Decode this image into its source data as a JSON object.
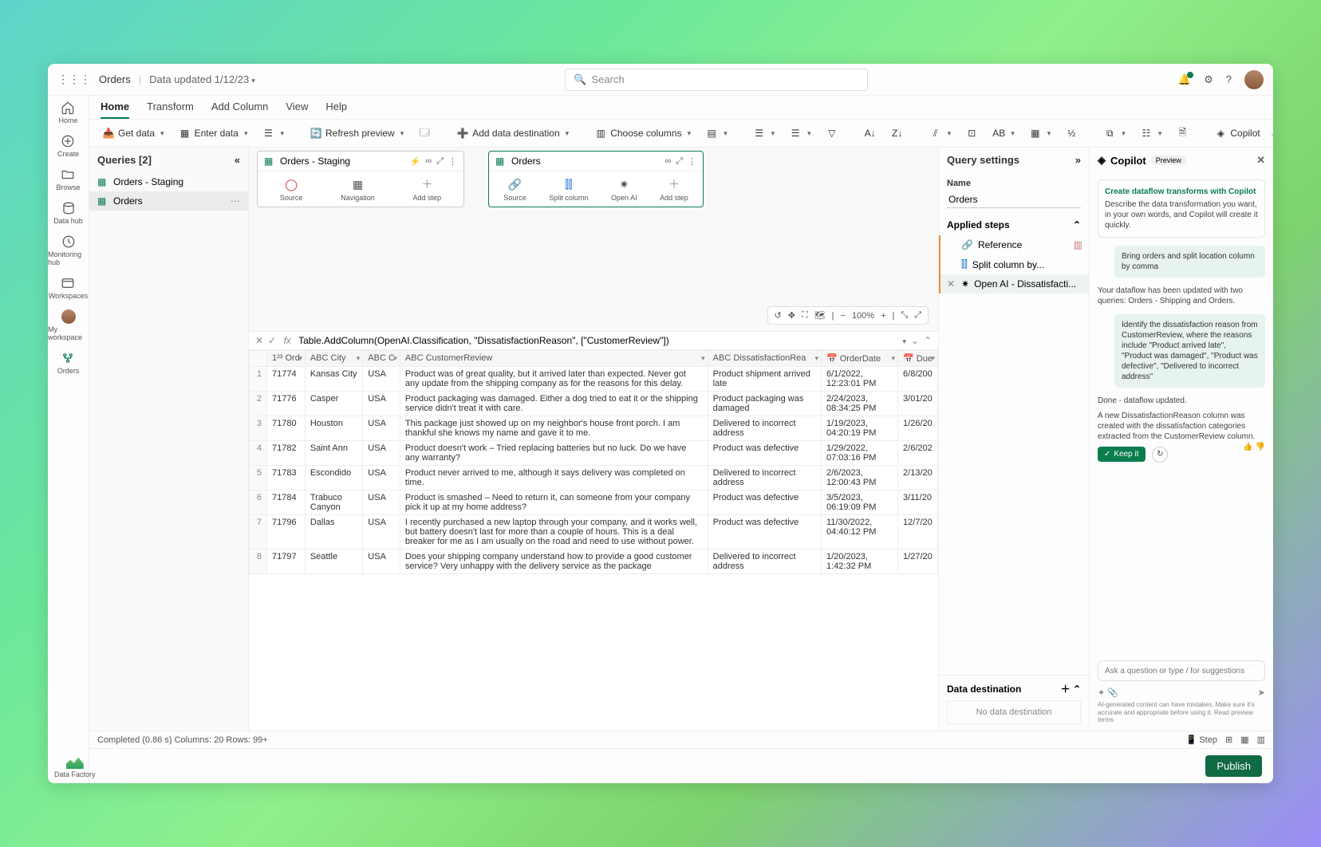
{
  "topbar": {
    "title": "Orders",
    "subtitle": "Data updated 1/12/23",
    "search_placeholder": "Search"
  },
  "rail": [
    {
      "label": "Home"
    },
    {
      "label": "Create"
    },
    {
      "label": "Browse"
    },
    {
      "label": "Data hub"
    },
    {
      "label": "Monitoring hub"
    },
    {
      "label": "Workspaces"
    },
    {
      "label": "My workspace"
    },
    {
      "label": "Orders"
    }
  ],
  "tabs": [
    "Home",
    "Transform",
    "Add Column",
    "View",
    "Help"
  ],
  "ribbon": {
    "get_data": "Get data",
    "enter_data": "Enter data",
    "refresh": "Refresh preview",
    "add_dest": "Add data destination",
    "choose_cols": "Choose columns",
    "copilot": "Copilot"
  },
  "queries": {
    "header": "Queries [2]",
    "items": [
      {
        "name": "Orders - Staging"
      },
      {
        "name": "Orders"
      }
    ]
  },
  "diagram": {
    "box1": {
      "title": "Orders - Staging",
      "steps": [
        "Source",
        "Navigation",
        "Add step"
      ]
    },
    "box2": {
      "title": "Orders",
      "steps": [
        "Source",
        "Split column",
        "Open AI",
        "Add step"
      ]
    },
    "zoom": "100%"
  },
  "formula": "Table.AddColumn(OpenAI.Classification, \"DissatisfactionReason\", [\"CustomerReview\"])",
  "grid": {
    "headers": [
      "",
      "1²³ Ord",
      "ABC City",
      "ABC C",
      "ABC CustomerReview",
      "ABC DissatisfactionRea",
      "📅 OrderDate",
      "📅 Due"
    ],
    "rows": [
      [
        "1",
        "71774",
        "Kansas City",
        "USA",
        "Product was of great quality, but it arrived later than expected. Never got any update from the shipping company as for the reasons for this delay.",
        "Product shipment arrived late",
        "6/1/2022, 12:23:01 PM",
        "6/8/200"
      ],
      [
        "2",
        "71776",
        "Casper",
        "USA",
        "Product packaging was damaged. Either a dog tried to eat it or the shipping service didn't treat it with care.",
        "Product packaging was damaged",
        "2/24/2023, 08:34:25 PM",
        "3/01/20"
      ],
      [
        "3",
        "71780",
        "Houston",
        "USA",
        "This package just showed up on my neighbor's house front porch. I am thankful she knows my name and gave it to me.",
        "Delivered to incorrect address",
        "1/19/2023, 04:20:19 PM",
        "1/26/20"
      ],
      [
        "4",
        "71782",
        "Saint Ann",
        "USA",
        "Product doesn't work – Tried replacing batteries but no luck. Do we have any warranty?",
        "Product was defective",
        "1/29/2022, 07:03:16 PM",
        "2/6/202"
      ],
      [
        "5",
        "71783",
        "Escondido",
        "USA",
        "Product never arrived to me, although it says delivery was completed on time.",
        "Delivered to incorrect address",
        "2/6/2023, 12:00:43 PM",
        "2/13/20"
      ],
      [
        "6",
        "71784",
        "Trabuco Canyon",
        "USA",
        "Product is smashed – Need to return it, can someone from your company pick it up at my home address?",
        "Product was defective",
        "3/5/2023, 06:19:09 PM",
        "3/11/20"
      ],
      [
        "7",
        "71796",
        "Dallas",
        "USA",
        "I recently purchased a new laptop through your company, and it works well, but battery doesn't last for more than a couple of hours. This is a deal breaker for me as I am usually on the road and need to use without power.",
        "Product was defective",
        "11/30/2022, 04:40:12 PM",
        "12/7/20"
      ],
      [
        "8",
        "71797",
        "Seattle",
        "USA",
        "Does your shipping company understand how to provide a good customer service? Very unhappy with the delivery service as the package",
        "Delivered to incorrect address",
        "1/20/2023, 1:42:32 PM",
        "1/27/20"
      ]
    ]
  },
  "settings": {
    "title": "Query settings",
    "name_label": "Name",
    "name_value": "Orders",
    "applied_label": "Applied steps",
    "steps": [
      {
        "name": "Reference"
      },
      {
        "name": "Split column by..."
      },
      {
        "name": "Open AI - Dissatisfacti..."
      }
    ],
    "dest_label": "Data destination",
    "no_dest": "No data destination"
  },
  "copilot": {
    "title": "Copilot",
    "preview": "Preview",
    "hero_title": "Create dataflow transforms with Copilot",
    "hero_body": "Describe the data transformation you want, in your own words, and Copilot will create it quickly.",
    "u1": "Bring orders and split location column by comma",
    "a1": "Your dataflow has been updated with two queries:  Orders - Shipping and Orders.",
    "u2": "Identify the dissatisfaction reason from CustomerReview, where the reasons include \"Product arrived late\", \"Product was damaged\", \"Product was defective\", \"Delivered to incorrect address\"",
    "a2a": "Done - dataflow updated.",
    "a2b": "A new DissatisfactionReason column was created with the dissatisfaction categories extracted from the CustomerReview column.",
    "keep_it": "Keep it",
    "input_placeholder": "Ask a question or type / for suggestions",
    "disclaimer": "AI-generated content can have mistakes. Make sure it's accurate and appropriate before using it. Read preview terms"
  },
  "status": {
    "text": "Completed (0.86 s)  Columns: 20  Rows: 99+",
    "step_label": "Step"
  },
  "footer": {
    "publish": "Publish",
    "df": "Data Factory"
  }
}
